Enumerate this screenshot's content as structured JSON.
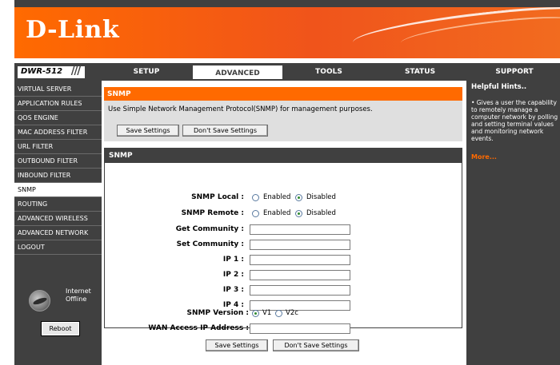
{
  "brand": {
    "logo": "D-Link"
  },
  "nav": {
    "model": "DWR-512",
    "tabs": [
      {
        "label": "SETUP"
      },
      {
        "label": "ADVANCED"
      },
      {
        "label": "TOOLS"
      },
      {
        "label": "STATUS"
      },
      {
        "label": "SUPPORT"
      }
    ],
    "active_tab": "ADVANCED"
  },
  "sidebar": {
    "items": [
      {
        "label": "VIRTUAL SERVER"
      },
      {
        "label": "APPLICATION RULES"
      },
      {
        "label": "QOS ENGINE"
      },
      {
        "label": "MAC ADDRESS FILTER"
      },
      {
        "label": "URL FILTER"
      },
      {
        "label": "OUTBOUND FILTER"
      },
      {
        "label": "INBOUND FILTER"
      },
      {
        "label": "SNMP"
      },
      {
        "label": "ROUTING"
      },
      {
        "label": "ADVANCED WIRELESS"
      },
      {
        "label": "ADVANCED NETWORK"
      },
      {
        "label": "LOGOUT"
      }
    ],
    "active_item": "SNMP",
    "status_line1": "Internet",
    "status_line2": "Offline",
    "reboot_label": "Reboot"
  },
  "intro": {
    "title": "SNMP",
    "description": "Use Simple Network Management Protocol(SNMP) for management purposes.",
    "save_label": "Save Settings",
    "dont_save_label": "Don't Save Settings"
  },
  "snmp": {
    "title": "SNMP",
    "local_label": "SNMP Local :",
    "remote_label": "SNMP Remote :",
    "enabled_label": "Enabled",
    "disabled_label": "Disabled",
    "local_value": "Disabled",
    "remote_value": "Disabled",
    "get_community_label": "Get Community :",
    "get_community_value": "",
    "set_community_label": "Set Community :",
    "set_community_value": "",
    "ip1_label": "IP 1 :",
    "ip1_value": "",
    "ip2_label": "IP 2 :",
    "ip2_value": "",
    "ip3_label": "IP 3 :",
    "ip3_value": "",
    "ip4_label": "IP 4 :",
    "ip4_value": "",
    "version_label": "SNMP Version :",
    "v1_label": "V1",
    "v2c_label": "V2c",
    "version_value": "V1",
    "wan_ip_label": "WAN Access IP Address :",
    "wan_ip_value": ""
  },
  "footer": {
    "save_label": "Save Settings",
    "dont_save_label": "Don't Save Settings"
  },
  "help": {
    "title": "Helpful Hints..",
    "body": "• Gives a user the capability to remotely manage a computer network by polling and setting terminal values and monitoring network events.",
    "more": "More..."
  },
  "colors": {
    "brand_orange": "#ff6a00",
    "dark_gray": "#404040",
    "panel_gray": "#dfdfdf"
  }
}
